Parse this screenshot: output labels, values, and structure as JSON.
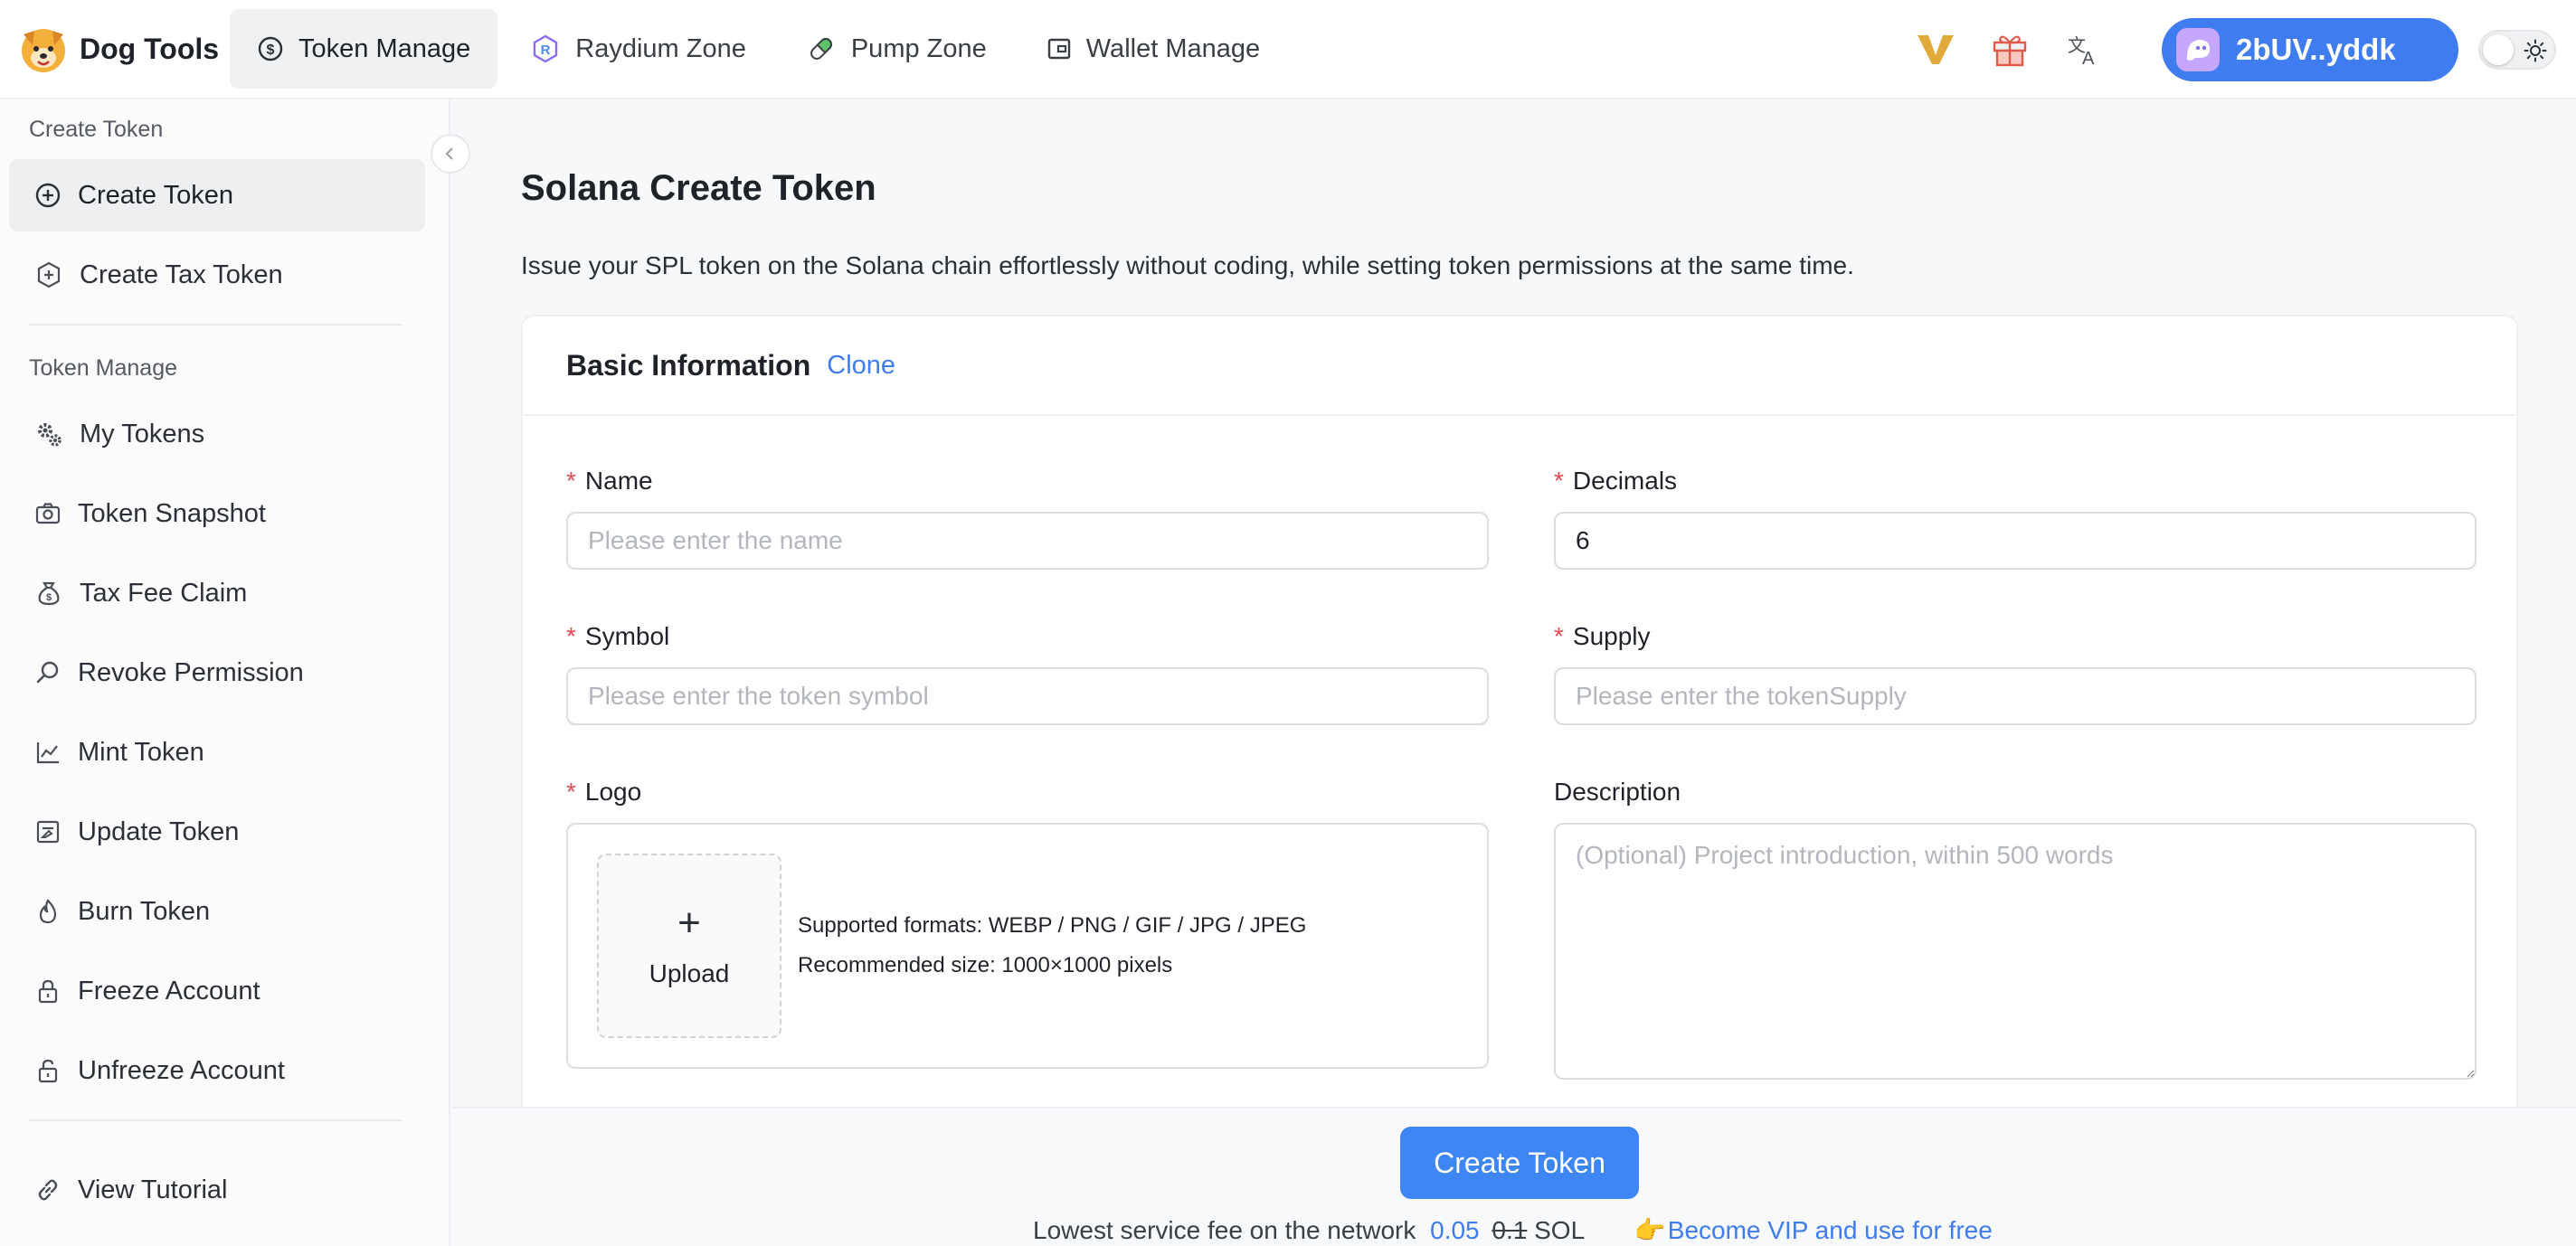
{
  "brand": {
    "name": "Dog Tools"
  },
  "nav": {
    "tabs": [
      {
        "label": "Token Manage",
        "icon": "dollar-circle-icon",
        "active": true
      },
      {
        "label": "Raydium Zone",
        "icon": "raydium-icon",
        "active": false
      },
      {
        "label": "Pump Zone",
        "icon": "pill-icon",
        "active": false
      },
      {
        "label": "Wallet Manage",
        "icon": "wallet-icon",
        "active": false
      }
    ]
  },
  "topbar": {
    "vip_icon": "vip-v-icon",
    "gift_icon": "gift-icon",
    "language_icon": "translate-icon",
    "wallet_label": "2bUV..yddk",
    "theme_icon": "sun-icon"
  },
  "sidebar": {
    "groups": [
      {
        "title": "Create Token",
        "items": [
          {
            "label": "Create Token",
            "icon": "plus-circle-icon",
            "active": true
          },
          {
            "label": "Create Tax Token",
            "icon": "tax-plus-icon",
            "active": false
          }
        ]
      },
      {
        "title": "Token Manage",
        "items": [
          {
            "label": "My Tokens",
            "icon": "gears-icon"
          },
          {
            "label": "Token Snapshot",
            "icon": "camera-icon"
          },
          {
            "label": "Tax Fee Claim",
            "icon": "money-bag-icon"
          },
          {
            "label": "Revoke Permission",
            "icon": "search-icon"
          },
          {
            "label": "Mint Token",
            "icon": "line-chart-icon"
          },
          {
            "label": "Update Token",
            "icon": "edit-box-icon"
          },
          {
            "label": "Burn Token",
            "icon": "flame-icon"
          },
          {
            "label": "Freeze Account",
            "icon": "lock-icon"
          },
          {
            "label": "Unfreeze Account",
            "icon": "unlock-icon"
          }
        ]
      }
    ],
    "tutorial": {
      "label": "View Tutorial",
      "icon": "link-icon"
    }
  },
  "page": {
    "title": "Solana Create Token",
    "description": "Issue your SPL token on the Solana chain effortlessly without coding, while setting token permissions at the same time."
  },
  "form": {
    "section_title": "Basic Information",
    "clone_label": "Clone",
    "name": {
      "label": "Name",
      "placeholder": "Please enter the name",
      "value": ""
    },
    "decimals": {
      "label": "Decimals",
      "placeholder": "",
      "value": "6"
    },
    "symbol": {
      "label": "Symbol",
      "placeholder": "Please enter the token symbol",
      "value": ""
    },
    "supply": {
      "label": "Supply",
      "placeholder": "Please enter the tokenSupply",
      "value": ""
    },
    "logo": {
      "label": "Logo",
      "upload_label": "Upload",
      "formats_hint": "Supported formats: WEBP / PNG / GIF / JPG / JPEG",
      "size_hint": "Recommended size: 1000×1000 pixels"
    },
    "description": {
      "label": "Description",
      "placeholder": "(Optional) Project introduction, within 500 words"
    }
  },
  "footer": {
    "create_label": "Create Token",
    "fee_text": "Lowest service fee on the network",
    "fee_price": "0.05",
    "fee_old_price": "0.1",
    "fee_unit": "SOL",
    "vip_icon": "pointing-hand-icon",
    "vip_label": "Become VIP and use for free"
  }
}
